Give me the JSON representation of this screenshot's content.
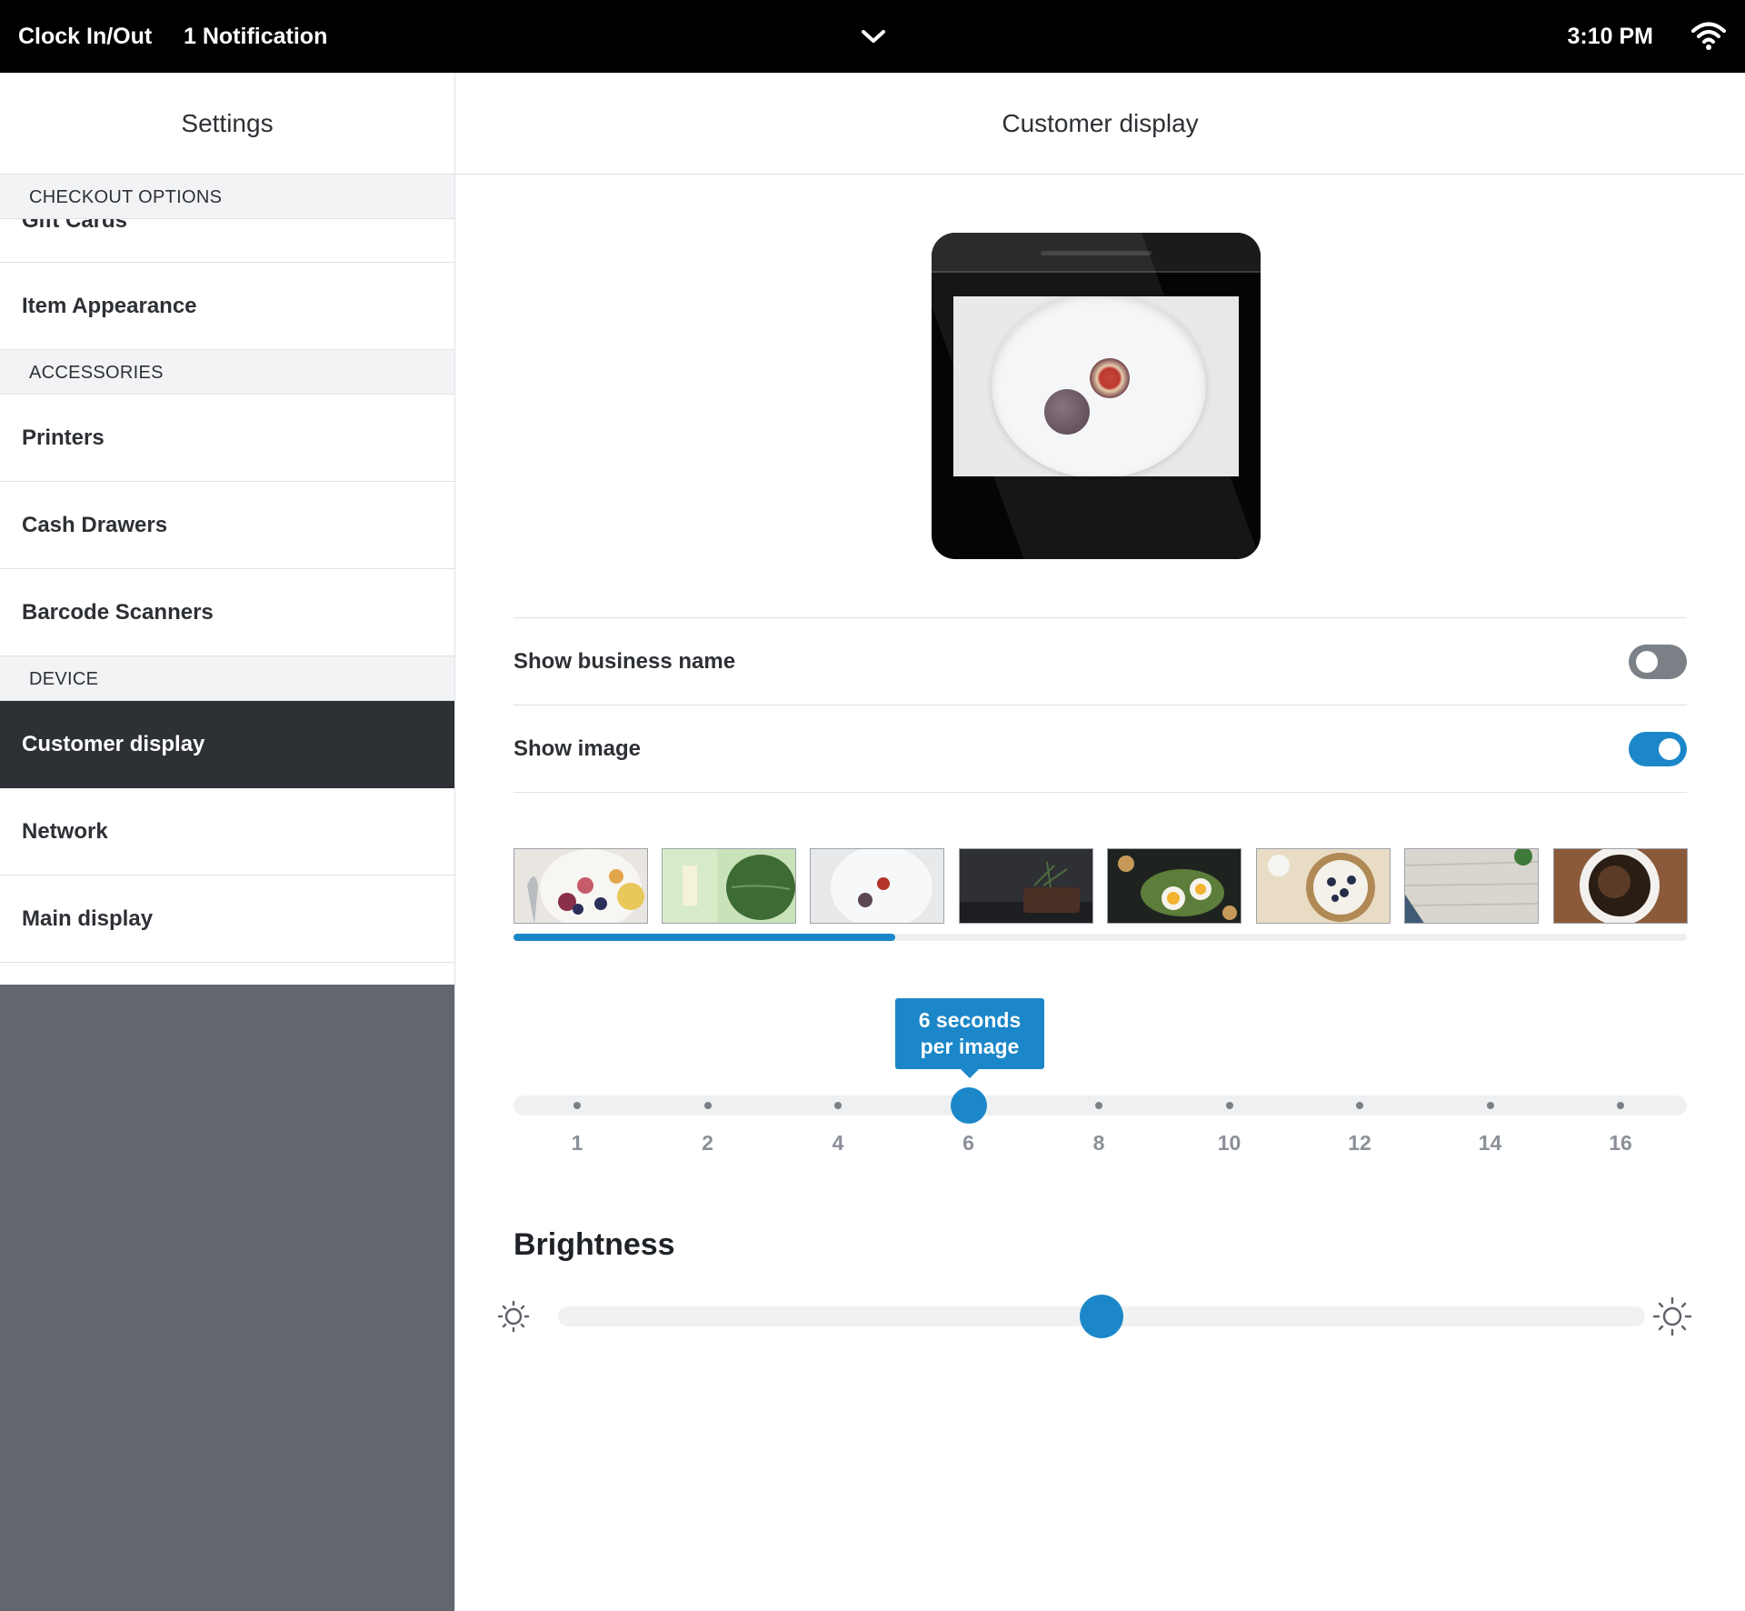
{
  "topbar": {
    "clock_label": "Clock In/Out",
    "notification_label": "1 Notification",
    "time": "3:10 PM",
    "chevron_icon": "chevron-down-icon",
    "wifi_icon": "wifi-icon"
  },
  "sidebar": {
    "title": "Settings",
    "sections": {
      "checkout": "CHECKOUT OPTIONS",
      "accessories": "ACCESSORIES",
      "device": "DEVICE"
    },
    "items": {
      "gift_cards": "Gift Cards",
      "item_appearance": "Item Appearance",
      "printers": "Printers",
      "cash_drawers": "Cash Drawers",
      "barcode_scanners": "Barcode Scanners",
      "customer_display": "Customer display",
      "network": "Network",
      "main_display": "Main display"
    },
    "active_item": "customer_display"
  },
  "main": {
    "title": "Customer display",
    "show_business_name": {
      "label": "Show business name",
      "enabled": false
    },
    "show_image": {
      "label": "Show image",
      "enabled": true
    },
    "thumbnails": [
      "fruit-bowl",
      "spinach-leaf",
      "figs-plate",
      "bread-loaf",
      "egg-avocado-toast",
      "yogurt-berries",
      "wood-board",
      "coffee-cup"
    ],
    "selected_thumbnail": 2,
    "thumbnail_scroll_fraction": 0.325,
    "seconds_slider": {
      "tooltip_line1": "6 seconds",
      "tooltip_line2": "per image",
      "ticks": [
        "1",
        "2",
        "4",
        "6",
        "8",
        "10",
        "12",
        "14",
        "16"
      ],
      "selected_value": "6"
    },
    "brightness": {
      "title": "Brightness",
      "level_fraction": 0.5,
      "low_icon": "sun-low-icon",
      "high_icon": "sun-high-icon"
    }
  },
  "colors": {
    "accent": "#1b87c9",
    "topbar_bg": "#000000",
    "sidebar_active": "#2d3035",
    "sidebar_empty": "#62666e"
  }
}
